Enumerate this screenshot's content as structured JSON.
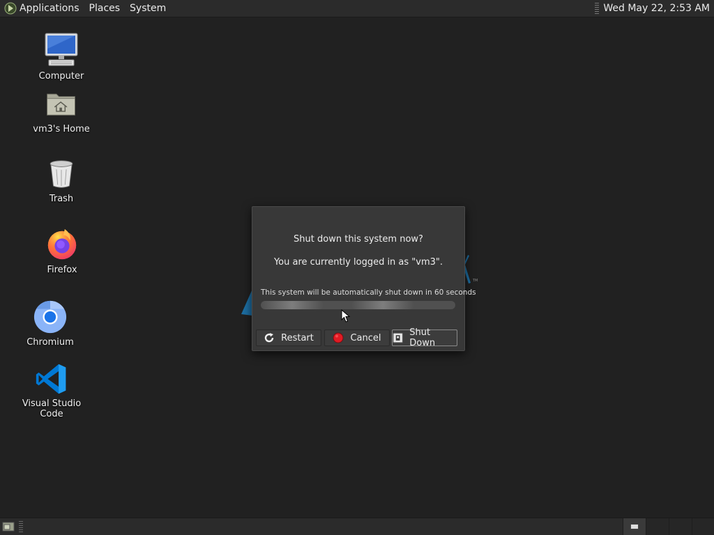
{
  "top_panel": {
    "menus": [
      "Applications",
      "Places",
      "System"
    ],
    "clock": "Wed May 22,  2:53 AM"
  },
  "desktop_icons": [
    {
      "label": "Computer",
      "icon": "computer-icon"
    },
    {
      "label": "vm3's Home",
      "icon": "home-folder-icon"
    },
    {
      "label": "Trash",
      "icon": "trash-icon"
    },
    {
      "label": "Firefox",
      "icon": "firefox-icon"
    },
    {
      "label": "Chromium",
      "icon": "chromium-icon"
    },
    {
      "label": "Visual Studio Code",
      "icon": "vscode-icon"
    }
  ],
  "dialog": {
    "question": "Shut down this system now?",
    "logged_in": "You are currently logged in as \"vm3\".",
    "countdown": "This system will be automatically shut down in 60 seconds",
    "progress": 0,
    "buttons": {
      "restart": "Restart",
      "cancel": "Cancel",
      "shutdown": "Shut Down"
    },
    "accent_colors": {
      "cancel_icon": "#e01b24",
      "background": "#383838"
    }
  },
  "bottom_panel": {
    "workspaces": 4,
    "active_workspace": 1
  }
}
